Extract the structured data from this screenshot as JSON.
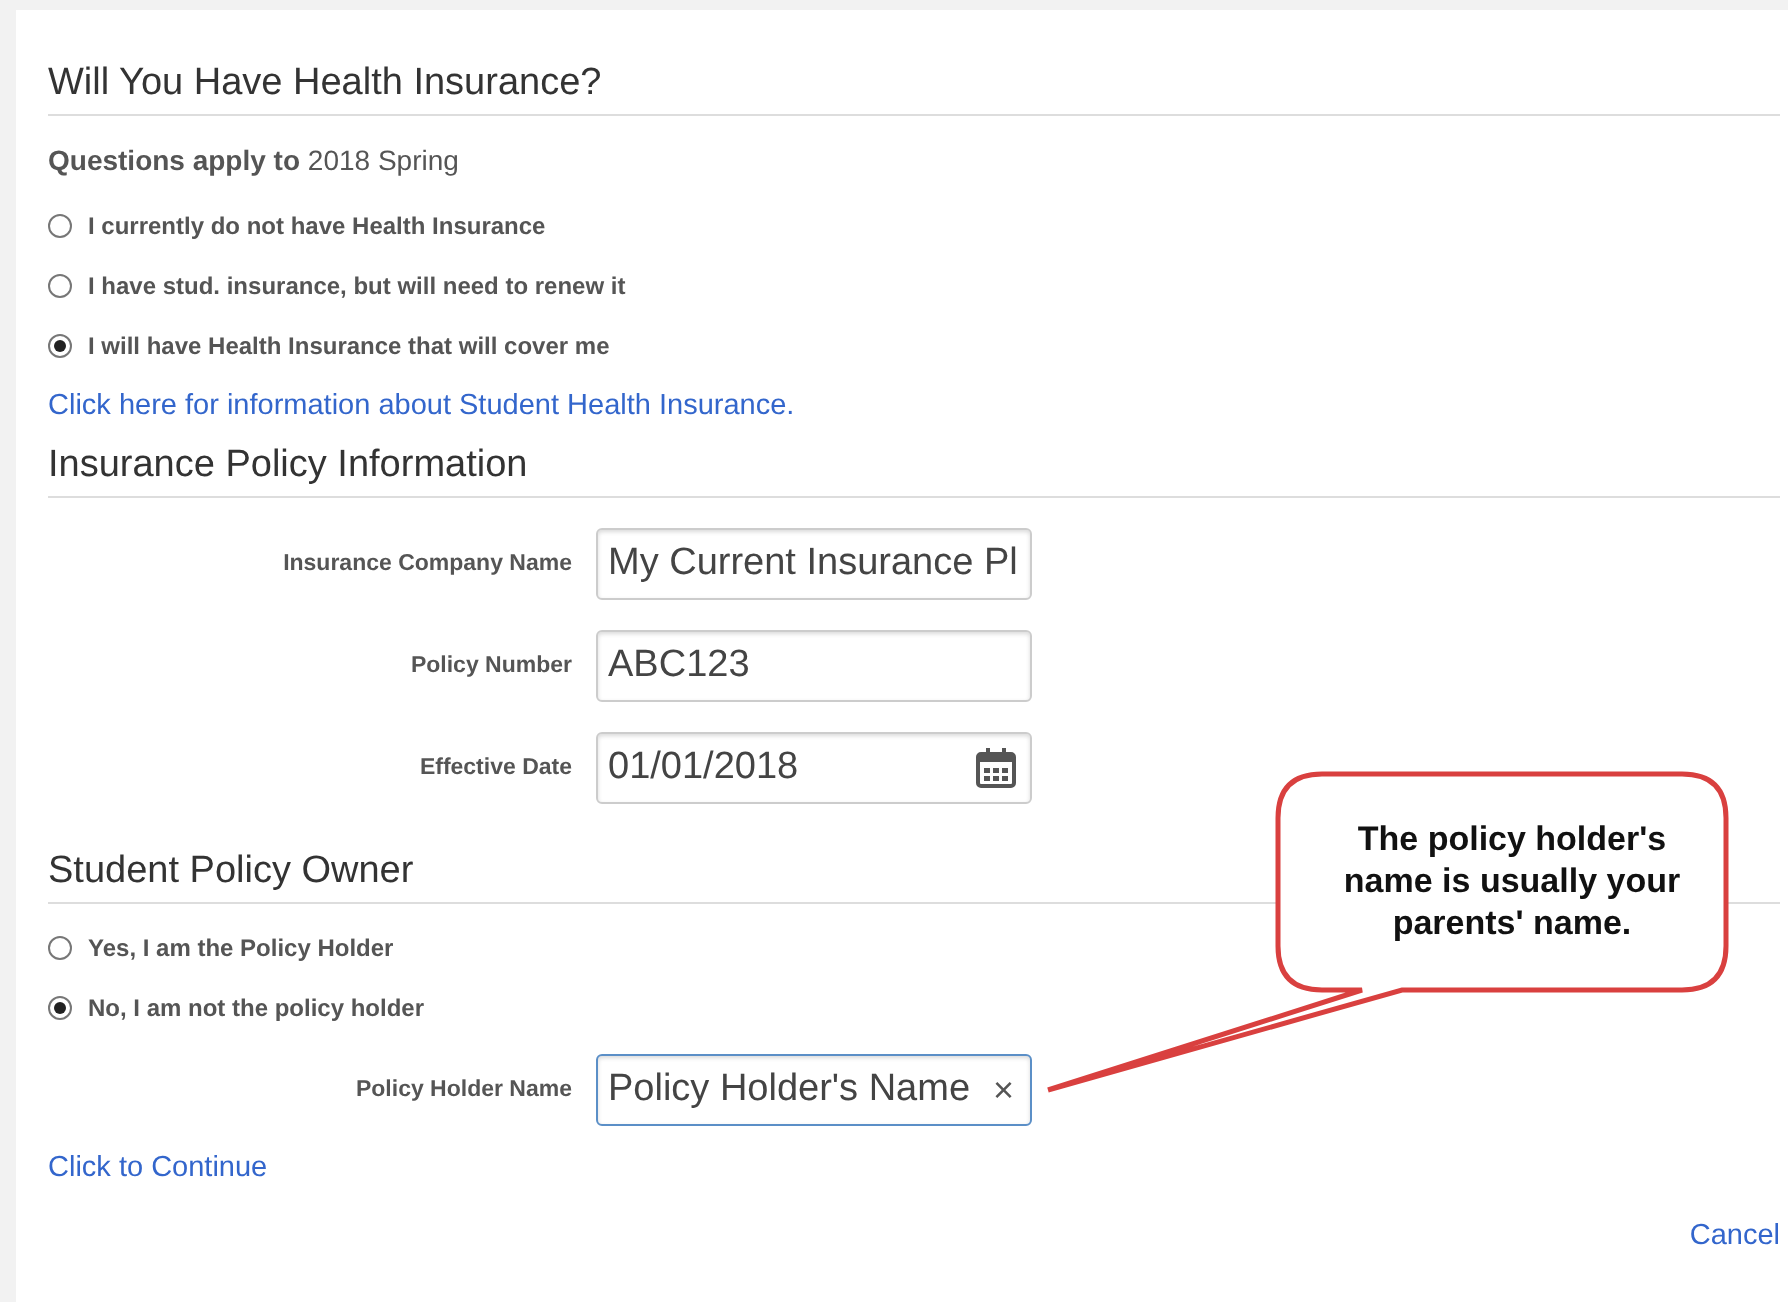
{
  "health_section": {
    "title": "Will You Have Health Insurance?",
    "term_label": "Questions apply to",
    "term_value": "2018 Spring",
    "options": [
      {
        "label": "I currently do not have Health Insurance",
        "selected": false
      },
      {
        "label": "I have stud. insurance, but will need to renew it",
        "selected": false
      },
      {
        "label": "I will have Health Insurance that will cover me",
        "selected": true
      }
    ],
    "info_link": "Click here for information about Student Health Insurance."
  },
  "policy_section": {
    "title": "Insurance Policy Information",
    "fields": [
      {
        "label": "Insurance Company Name",
        "value": "My Current Insurance Pl",
        "kind": "text"
      },
      {
        "label": "Policy Number",
        "value": "ABC123",
        "kind": "text"
      },
      {
        "label": "Effective Date",
        "value": "01/01/2018",
        "kind": "date"
      }
    ]
  },
  "owner_section": {
    "title": "Student Policy Owner",
    "options": [
      {
        "label": "Yes, I am the Policy Holder",
        "selected": false
      },
      {
        "label": "No, I am not the policy holder",
        "selected": true
      }
    ],
    "holder_field": {
      "label": "Policy Holder Name",
      "value": "Policy Holder's Name",
      "clear": "×"
    }
  },
  "continue_link": "Click to Continue",
  "cancel_link": "Cancel",
  "callout": "The policy holder's name is usually your parents' name."
}
